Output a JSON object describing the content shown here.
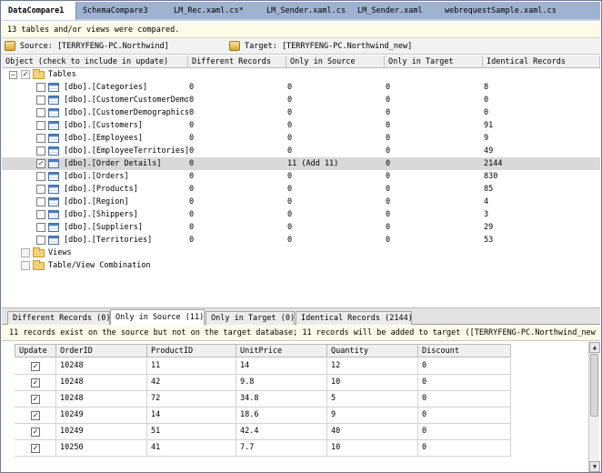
{
  "doc_tabs": [
    {
      "label": "DataCompare1"
    },
    {
      "label": "SchemaCompare3"
    },
    {
      "label": "LM_Rec.xaml.cs*"
    },
    {
      "label": "LM_Sender.xaml.cs"
    },
    {
      "label": "LM_Sender.xaml"
    },
    {
      "label": "webrequestSample.xaml.cs"
    }
  ],
  "summary": "13 tables and/or views were compared.",
  "source": "Source: [TERRYFENG-PC.Northwind]",
  "target": "Target: [TERRYFENG-PC.Northwind_new]",
  "tree_headers": [
    "Object (check to include in update)",
    "Different Records",
    "Only in Source",
    "Only in Target",
    "Identical Records"
  ],
  "tables_label": "Tables",
  "tables": [
    {
      "name": "[dbo].[Categories]",
      "diff": "0",
      "src": "0",
      "tgt": "0",
      "ident": "8",
      "checked": false
    },
    {
      "name": "[dbo].[CustomerCustomerDemo]",
      "diff": "0",
      "src": "0",
      "tgt": "0",
      "ident": "0",
      "checked": false
    },
    {
      "name": "[dbo].[CustomerDemographics]",
      "diff": "0",
      "src": "0",
      "tgt": "0",
      "ident": "0",
      "checked": false
    },
    {
      "name": "[dbo].[Customers]",
      "diff": "0",
      "src": "0",
      "tgt": "0",
      "ident": "91",
      "checked": false
    },
    {
      "name": "[dbo].[Employees]",
      "diff": "0",
      "src": "0",
      "tgt": "0",
      "ident": "9",
      "checked": false
    },
    {
      "name": "[dbo].[EmployeeTerritories]",
      "diff": "0",
      "src": "0",
      "tgt": "0",
      "ident": "49",
      "checked": false
    },
    {
      "name": "[dbo].[Order Details]",
      "diff": "0",
      "src": "11 (Add 11)",
      "tgt": "0",
      "ident": "2144",
      "checked": true
    },
    {
      "name": "[dbo].[Orders]",
      "diff": "0",
      "src": "0",
      "tgt": "0",
      "ident": "830",
      "checked": false
    },
    {
      "name": "[dbo].[Products]",
      "diff": "0",
      "src": "0",
      "tgt": "0",
      "ident": "85",
      "checked": false
    },
    {
      "name": "[dbo].[Region]",
      "diff": "0",
      "src": "0",
      "tgt": "0",
      "ident": "4",
      "checked": false
    },
    {
      "name": "[dbo].[Shippers]",
      "diff": "0",
      "src": "0",
      "tgt": "0",
      "ident": "3",
      "checked": false
    },
    {
      "name": "[dbo].[Suppliers]",
      "diff": "0",
      "src": "0",
      "tgt": "0",
      "ident": "29",
      "checked": false
    },
    {
      "name": "[dbo].[Territories]",
      "diff": "0",
      "src": "0",
      "tgt": "0",
      "ident": "53",
      "checked": false
    }
  ],
  "views_label": "Views",
  "combo_label": "Table/View Combination",
  "result_tabs": [
    "Different Records (0)",
    "Only in Source (11)",
    "Only in Target (0)",
    "Identical Records (2144)"
  ],
  "message": "11 records exist on the source but not on the target database; 11 records will be added to target ([TERRYFENG-PC.Northwind_new",
  "detail_headers": [
    "Update",
    "OrderID",
    "ProductID",
    "UnitPrice",
    "Quantity",
    "Discount"
  ],
  "detail_rows": [
    {
      "order": "10248",
      "product": "11",
      "price": "14",
      "qty": "12",
      "disc": "0"
    },
    {
      "order": "10248",
      "product": "42",
      "price": "9.8",
      "qty": "10",
      "disc": "0"
    },
    {
      "order": "10248",
      "product": "72",
      "price": "34.8",
      "qty": "5",
      "disc": "0"
    },
    {
      "order": "10249",
      "product": "14",
      "price": "18.6",
      "qty": "9",
      "disc": "0"
    },
    {
      "order": "10249",
      "product": "51",
      "price": "42.4",
      "qty": "40",
      "disc": "0"
    },
    {
      "order": "10250",
      "product": "41",
      "price": "7.7",
      "qty": "10",
      "disc": "0"
    }
  ],
  "check_mark": "✓",
  "collapse_glyph": "−",
  "scroll_up": "▲",
  "scroll_down": "▼"
}
